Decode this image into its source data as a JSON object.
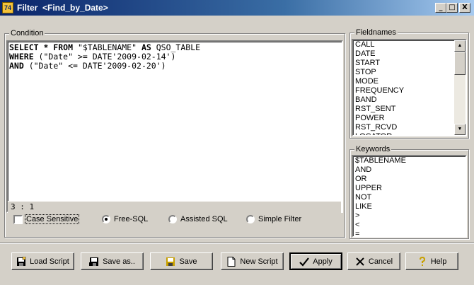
{
  "window": {
    "title": "Filter  <Find_by_Date>",
    "controls": {
      "minimize": "_",
      "maximize": "□",
      "close": "X"
    }
  },
  "condition": {
    "legend": "Condition",
    "sql_lines": [
      [
        {
          "t": "SELECT * FROM ",
          "kw": true
        },
        {
          "t": "\"$TABLENAME\" ",
          "kw": false
        },
        {
          "t": "AS ",
          "kw": true
        },
        {
          "t": "QSO_TABLE",
          "kw": false
        }
      ],
      [
        {
          "t": "WHERE ",
          "kw": true
        },
        {
          "t": "(\"Date\" >= DATE'2009-02-14')",
          "kw": false
        }
      ],
      [
        {
          "t": "AND ",
          "kw": true
        },
        {
          "t": "(\"Date\" <= DATE'2009-02-20')",
          "kw": false
        }
      ]
    ],
    "cursor_pos": "3 : 1"
  },
  "options": {
    "case_sensitive": {
      "label": "Case Sensitive",
      "checked": false
    },
    "modes": [
      {
        "label": "Free-SQL",
        "selected": true
      },
      {
        "label": "Assisted SQL",
        "selected": false
      },
      {
        "label": "Simple Filter",
        "selected": false
      }
    ]
  },
  "fieldnames": {
    "legend": "Fieldnames",
    "items": [
      "CALL",
      "DATE",
      "START",
      "STOP",
      "MODE",
      "FREQUENCY",
      "BAND",
      "RST_SENT",
      "POWER",
      "RST_RCVD",
      "LOCATOR"
    ]
  },
  "keywords": {
    "legend": "Keywords",
    "items": [
      "$TABLENAME",
      "AND",
      "OR",
      "UPPER",
      "NOT",
      "LIKE",
      ">",
      "<",
      "="
    ]
  },
  "buttons": {
    "load_script": "Load Script",
    "save_as": "Save as..",
    "save": "Save",
    "new_script": "New Script",
    "apply": "Apply",
    "cancel": "Cancel",
    "help": "Help"
  },
  "icons": {
    "load": "floppy-open-icon",
    "save_as": "floppy-save-as-icon",
    "save": "floppy-icon",
    "new": "new-document-icon",
    "apply": "checkmark-icon",
    "cancel": "x-icon",
    "help": "question-icon"
  }
}
